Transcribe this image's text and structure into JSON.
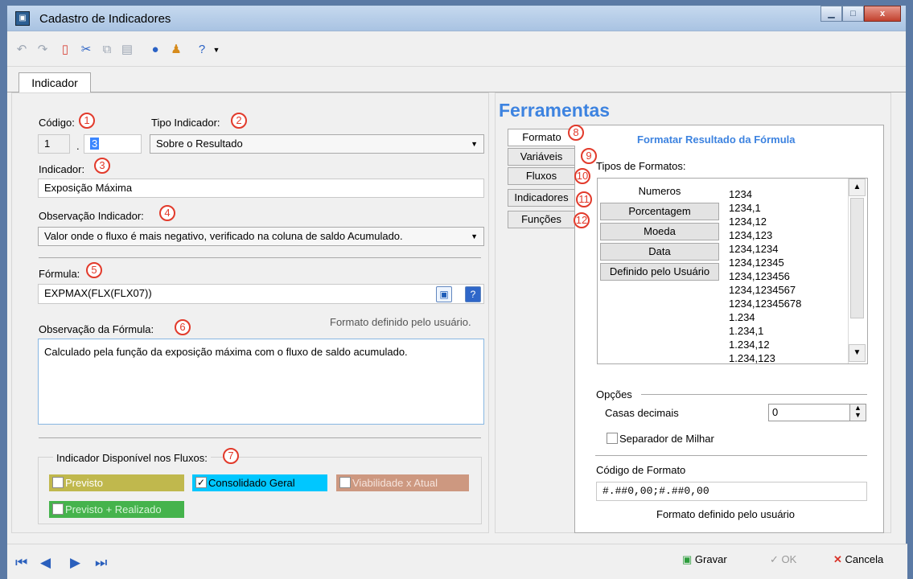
{
  "window": {
    "title": "Cadastro de Indicadores",
    "controls": [
      "minimize",
      "maximize",
      "close"
    ]
  },
  "toolbar": {
    "icons": [
      "undo-icon",
      "redo-icon",
      "new-document-icon",
      "cut-icon",
      "copy-icon",
      "paste-icon",
      "info-icon",
      "user-icon",
      "help-icon",
      "dropdown-icon"
    ]
  },
  "tabs": {
    "main": "Indicador"
  },
  "left": {
    "codigo_label": "Código:",
    "codigo_prefix": "1",
    "codigo_separator": ".",
    "codigo_value": "3",
    "tipo_label": "Tipo Indicador:",
    "tipo_value": "Sobre o Resultado",
    "indicador_label": "Indicador:",
    "indicador_value": "Exposição Máxima",
    "observacao_label": "Observação Indicador:",
    "observacao_value": "Valor onde o fluxo é mais negativo, verificado na coluna de saldo Acumulado.",
    "formula_label": "Fórmula:",
    "formula_value": "EXPMAX(FLX(FLX07))",
    "obs_formula_label": "Observação da Fórmula:",
    "formato_note": "Formato definido pelo usuário.",
    "obs_formula_value": "Calculado pela função da exposição máxima com o fluxo de saldo acumulado.",
    "flows_label": "Indicador Disponível nos Fluxos:",
    "flows": [
      {
        "label": "Previsto",
        "checked": false,
        "color": "#c0b84d"
      },
      {
        "label": "Consolidado Geral",
        "checked": true,
        "color": "#00c7ff"
      },
      {
        "label": "Viabilidade x Atual",
        "checked": false,
        "color": "#cd9880"
      },
      {
        "label": "Previsto + Realizado",
        "checked": false,
        "color": "#45b34c"
      }
    ]
  },
  "badges": [
    "1",
    "2",
    "3",
    "4",
    "5",
    "6",
    "7",
    "8",
    "9",
    "10",
    "11",
    "12"
  ],
  "tools": {
    "title": "Ferramentas",
    "tabs": [
      "Formato",
      "Variáveis",
      "Fluxos",
      "Indicadores",
      "Funções"
    ],
    "heading": "Formatar Resultado da Fórmula",
    "types_label": "Tipos de Formatos:",
    "format_buttons": [
      "Numeros",
      "Porcentagem",
      "Moeda",
      "Data",
      "Definido pelo Usuário"
    ],
    "format_items": [
      "1234",
      "1234,1",
      "1234,12",
      "1234,123",
      "1234,1234",
      "1234,12345",
      "1234,123456",
      "1234,1234567",
      "1234,12345678",
      "1.234",
      "1.234,1",
      "1.234,12",
      "1.234,123"
    ],
    "options_label": "Opções",
    "decimal_label": "Casas decimais",
    "decimal_value": "0",
    "thousands_label": "Separador de Milhar",
    "code_label": "Código de Formato",
    "code_value": "#.##0,00;#.##0,00",
    "bottom_note": "Formato definido pelo usuário"
  },
  "actions": {
    "save": "Gravar",
    "ok": "OK",
    "cancel": "Cancela"
  }
}
